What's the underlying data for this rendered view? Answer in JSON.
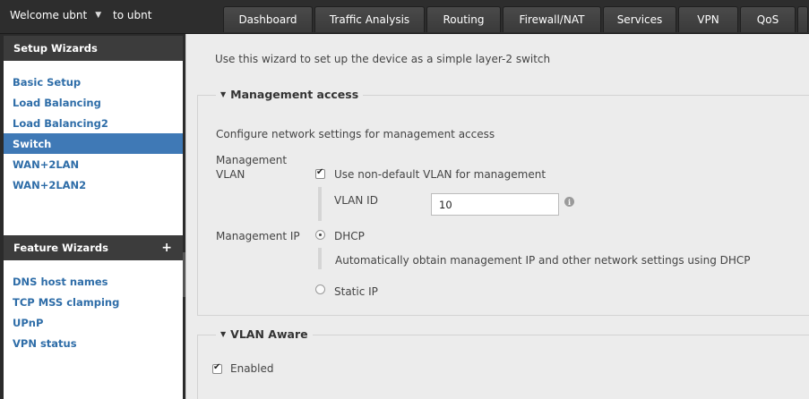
{
  "topbar": {
    "welcome": "Welcome ubnt",
    "to_ubnt": "to ubnt",
    "tabs": [
      "Dashboard",
      "Traffic Analysis",
      "Routing",
      "Firewall/NAT",
      "Services",
      "VPN",
      "QoS"
    ]
  },
  "sidebar": {
    "setup_header": "Setup Wizards",
    "setup_items": [
      "Basic Setup",
      "Load Balancing",
      "Load Balancing2",
      "Switch",
      "WAN+2LAN",
      "WAN+2LAN2"
    ],
    "active_item": "Switch",
    "feature_header": "Feature Wizards",
    "feature_plus": "+",
    "feature_items": [
      "DNS host names",
      "TCP MSS clamping",
      "UPnP",
      "VPN status"
    ]
  },
  "main": {
    "intro": "Use this wizard to set up the device as a simple layer-2 switch",
    "management": {
      "legend": "Management access",
      "description": "Configure network settings for management access",
      "vlan_label_line1": "Management",
      "vlan_label_line2": "VLAN",
      "use_vlan_label": "Use non-default VLAN for management",
      "use_vlan_checked": true,
      "vlan_id_label": "VLAN ID",
      "vlan_id_value": "10",
      "ip_label": "Management IP",
      "dhcp_label": "DHCP",
      "dhcp_selected": true,
      "dhcp_description": "Automatically obtain management IP and other network settings using DHCP",
      "static_label": "Static IP"
    },
    "vlan_aware": {
      "legend": "VLAN Aware",
      "enabled_label": "Enabled",
      "enabled_checked": true
    }
  },
  "colors": {
    "accent": "#3f79b6",
    "link": "#2e6da8",
    "topbar": "#2d2d2d"
  }
}
